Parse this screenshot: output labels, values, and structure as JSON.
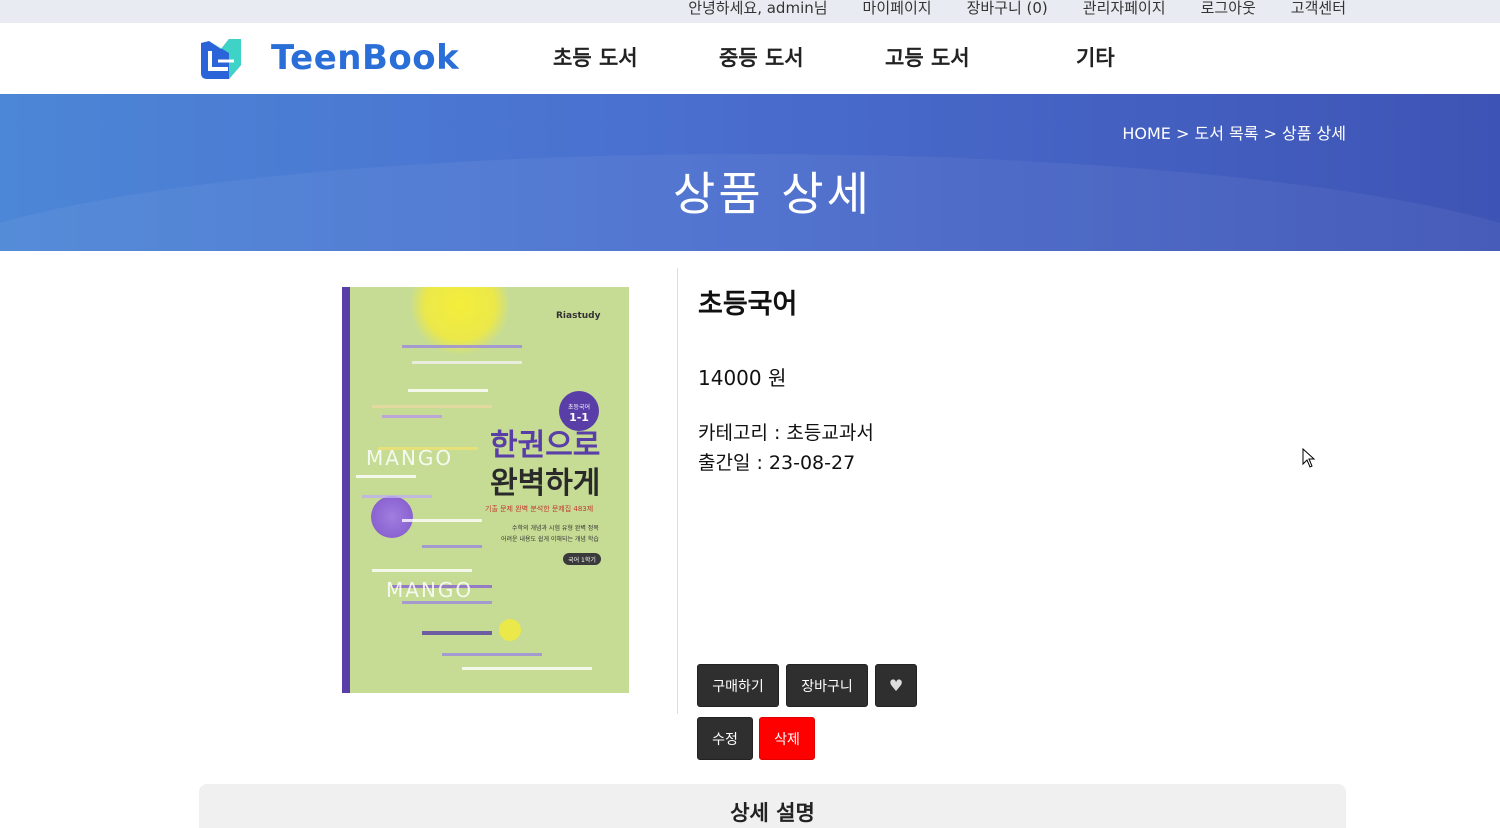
{
  "topbar": {
    "greeting": "안녕하세요, admin님",
    "mypage": "마이페이지",
    "cart": "장바구니 (0)",
    "admin": "관리자페이지",
    "logout": "로그아웃",
    "support": "고객센터"
  },
  "header": {
    "brand": "TeenBook",
    "nav": [
      "초등 도서",
      "중등 도서",
      "고등 도서",
      "기타"
    ]
  },
  "banner": {
    "breadcrumb": "HOME > 도서 목록 > 상품 상세",
    "title": "상품 상세"
  },
  "product": {
    "name": "초등국어",
    "price": "14000 원",
    "category": "카테고리 : 초등교과서",
    "release": "출간일 : 23-08-27",
    "cover": {
      "publisher": "Riastudy",
      "badge_top": "초등국어",
      "badge_bottom": "1-1",
      "headline1": "한권으로",
      "headline2": "완벽하게",
      "subtitle": "기출 문제 완벽 분석한 문제집 483제",
      "desc1": "수학의 개념과 시험 유형 완벽 정복",
      "desc2": "어려운 내용도 쉽게 이해되는 개념 학습",
      "tag": "국어 1학기",
      "mango": "MANGO"
    }
  },
  "actions": {
    "buy": "구매하기",
    "add_cart": "장바구니",
    "like": "♥",
    "edit": "수정",
    "delete": "삭제"
  },
  "detail": {
    "heading": "상세 설명"
  },
  "colors": {
    "brand": "#2a6ed8",
    "banner_start": "#4c86d6",
    "banner_end": "#3e54b5",
    "button_dark": "#2f2f2f",
    "button_red": "#ff0000",
    "cover_bg": "#c6dc94",
    "cover_spine": "#5a3ea8"
  }
}
